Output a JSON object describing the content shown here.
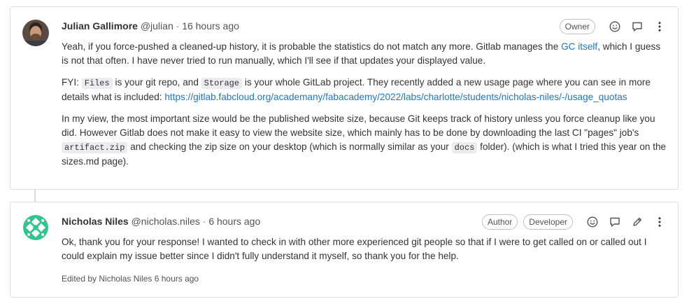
{
  "notes": [
    {
      "author_name": "Julian Gallimore",
      "author_handle": "@julian",
      "separator": "·",
      "time": "16 hours ago",
      "badges": [
        "Owner"
      ],
      "paragraphs": [
        {
          "t1": "Yeah, if you force-pushed a cleaned-up history, it is probable the statistics do not match any more. Gitlab manages the ",
          "link": "GC itself",
          "t2": ", which I guess is not that often. I have never tried to run manually, which I'll see if that updates your displayed value."
        },
        {
          "t1": "FYI: ",
          "code1": "Files",
          "t2": " is your git repo, and ",
          "code2": "Storage",
          "t3": " is your whole GitLab project. They recently added a new usage page where you can see in more details what is included: ",
          "link": "https://gitlab.fabcloud.org/academany/fabacademy/2022/labs/charlotte/students/nicholas-niles/-/usage_quotas"
        },
        {
          "t1": "In my view, the most important size would be the published website size, because Git keeps track of history unless you force cleanup like you did. However Gitlab does not make it easy to view the website size, which mainly has to be done by downloading the last CI \"pages\" job's ",
          "code1": "artifact.zip",
          "t2": " and checking the zip size on your desktop (which is normally similar as your ",
          "code2": "docs",
          "t3": " folder). (which is what I tried this year on the sizes.md page)."
        }
      ]
    },
    {
      "author_name": "Nicholas Niles",
      "author_handle": "@nicholas.niles",
      "separator": "·",
      "time": "6 hours ago",
      "badges": [
        "Author",
        "Developer"
      ],
      "text": "Ok, thank you for your response! I wanted to check in with other more experienced git people so that if I were to get called on or called out I could explain my issue better since I didn't fully understand it myself, so thank you for the help.",
      "edited": "Edited by Nicholas Niles 6 hours ago"
    }
  ],
  "icons": {
    "emoji": "smiley-icon",
    "reply": "comment-icon",
    "edit": "pencil-icon",
    "more": "kebab-menu-icon"
  },
  "colors": {
    "link": "#1f75cb",
    "border": "#dcdcde",
    "text": "#333238"
  }
}
